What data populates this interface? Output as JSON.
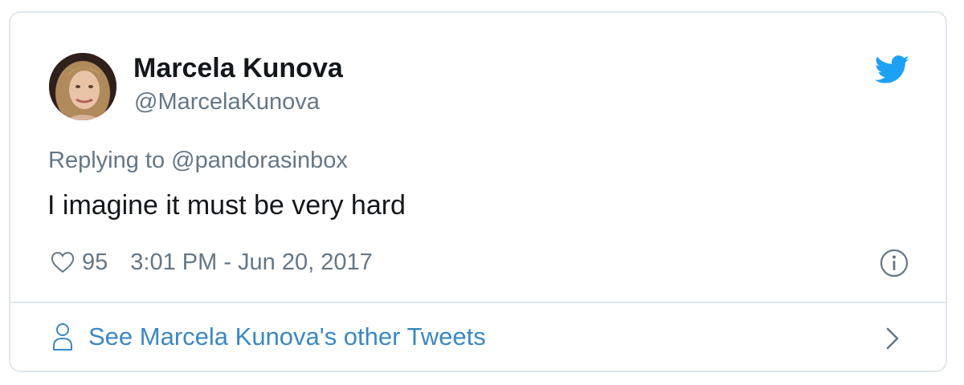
{
  "author": {
    "name": "Marcela Kunova",
    "handle": "@MarcelaKunova"
  },
  "reply": {
    "prefix": "Replying to",
    "mention": "@pandorasinbox"
  },
  "tweet": {
    "text": "I imagine it must be very hard"
  },
  "meta": {
    "likes": "95",
    "timestamp": "3:01 PM - Jun 20, 2017"
  },
  "footer": {
    "link_text": "See Marcela Kunova's other Tweets"
  },
  "icons": {
    "brand": "twitter-bird-icon",
    "like": "heart-icon",
    "info": "info-icon",
    "profile": "person-icon",
    "chevron": "chevron-right-icon"
  },
  "colors": {
    "brand_blue": "#1da1f2",
    "link_blue": "#3b88c3",
    "secondary_text": "#657786",
    "primary_text": "#14171a",
    "border": "#e1e8ed"
  }
}
